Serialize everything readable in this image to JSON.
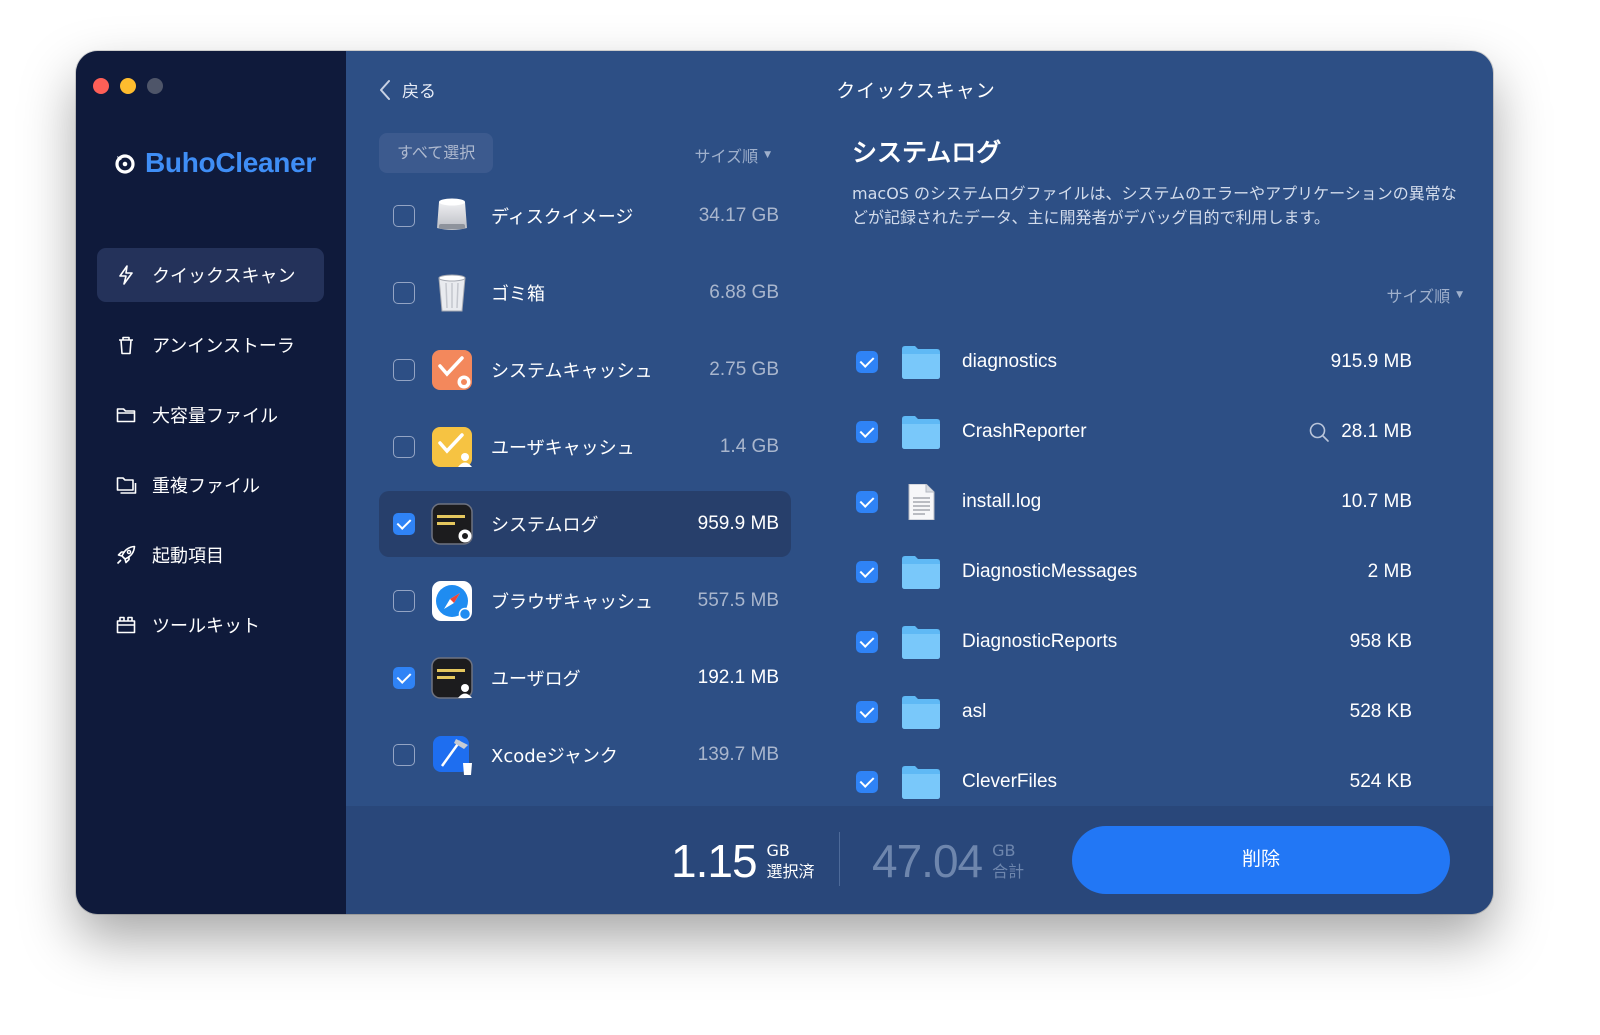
{
  "app": {
    "name": "BuhoCleaner"
  },
  "sidebar": {
    "items": [
      {
        "label": "クイックスキャン",
        "icon": "bolt-icon",
        "active": true
      },
      {
        "label": "アンインストーラ",
        "icon": "trash-icon"
      },
      {
        "label": "大容量ファイル",
        "icon": "folder-icon"
      },
      {
        "label": "重複ファイル",
        "icon": "duplicate-folder-icon"
      },
      {
        "label": "起動項目",
        "icon": "rocket-icon"
      },
      {
        "label": "ツールキット",
        "icon": "toolbox-icon"
      }
    ]
  },
  "header": {
    "back_label": "戻る",
    "title": "クイックスキャン"
  },
  "list": {
    "select_all_label": "すべて選択",
    "sort_label": "サイズ順",
    "items": [
      {
        "label": "ディスクイメージ",
        "size": "34.17 GB",
        "checked": false,
        "icon": "disk-image-icon"
      },
      {
        "label": "ゴミ箱",
        "size": "6.88 GB",
        "checked": false,
        "icon": "trash-bin-icon"
      },
      {
        "label": "システムキャッシュ",
        "size": "2.75 GB",
        "checked": false,
        "icon": "system-cache-icon"
      },
      {
        "label": "ユーザキャッシュ",
        "size": "1.4 GB",
        "checked": false,
        "icon": "user-cache-icon"
      },
      {
        "label": "システムログ",
        "size": "959.9 MB",
        "checked": true,
        "selected": true,
        "icon": "system-log-icon"
      },
      {
        "label": "ブラウザキャッシュ",
        "size": "557.5 MB",
        "checked": false,
        "icon": "browser-cache-icon"
      },
      {
        "label": "ユーザログ",
        "size": "192.1 MB",
        "checked": true,
        "icon": "user-log-icon"
      },
      {
        "label": "Xcodeジャンク",
        "size": "139.7 MB",
        "checked": false,
        "icon": "xcode-junk-icon"
      }
    ]
  },
  "detail": {
    "title": "システムログ",
    "description": "macOS のシステムログファイルは、システムのエラーやアプリケーションの異常などが記録されたデータ、主に開発者がデバッグ目的で利用します。",
    "sort_label": "サイズ順",
    "files": [
      {
        "name": "diagnostics",
        "size": "915.9 MB",
        "type": "folder",
        "checked": true
      },
      {
        "name": "CrashReporter",
        "size": "28.1 MB",
        "type": "folder",
        "checked": true,
        "search": true
      },
      {
        "name": "install.log",
        "size": "10.7 MB",
        "type": "file",
        "checked": true
      },
      {
        "name": "DiagnosticMessages",
        "size": "2 MB",
        "type": "folder",
        "checked": true
      },
      {
        "name": "DiagnosticReports",
        "size": "958 KB",
        "type": "folder",
        "checked": true
      },
      {
        "name": "asl",
        "size": "528 KB",
        "type": "folder",
        "checked": true
      },
      {
        "name": "CleverFiles",
        "size": "524 KB",
        "type": "folder",
        "checked": true
      }
    ]
  },
  "footer": {
    "selected_value": "1.15",
    "selected_unit": "GB",
    "selected_label": "選択済",
    "total_value": "47.04",
    "total_unit": "GB",
    "total_label": "合計",
    "delete_label": "削除"
  },
  "colors": {
    "accent": "#2277f5",
    "brand": "#3f8ef6",
    "sidebar_bg": "#0f1a3b",
    "panel_bg": "#2d4f85"
  }
}
